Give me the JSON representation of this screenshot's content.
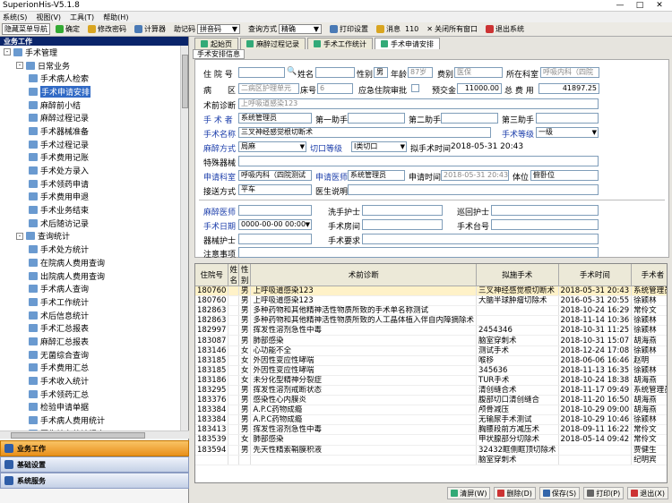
{
  "window": {
    "title": "SuperionHis-V5.1.8",
    "min": "—",
    "max": "□",
    "close": "✕"
  },
  "menu": [
    "系统(S)",
    "视图(V)",
    "工具(T)",
    "帮助(H)"
  ],
  "toolbar": {
    "hide_nav": "隐藏菜单导航",
    "confirm": "确定",
    "change_pwd": "修改密码",
    "calculator": "计算器",
    "mnemonic_label": "助记码",
    "mnemonic_value": "拼音码",
    "query_mode_label": "查询方式",
    "query_mode_value": "精确",
    "print_setup": "打印设置",
    "message_label": "消息",
    "message_count": "110",
    "close_all": "关闭所有窗口",
    "exit": "退出系统"
  },
  "sidebar": {
    "header": "业务工作",
    "tree": [
      {
        "label": "手术管理",
        "level": 0,
        "exp": "-"
      },
      {
        "label": "日常业务",
        "level": 1,
        "exp": "-"
      },
      {
        "label": "手术病人检索",
        "level": 2
      },
      {
        "label": "手术申请安排",
        "level": 2,
        "selected": true
      },
      {
        "label": "麻醉前小结",
        "level": 2
      },
      {
        "label": "麻醉过程记录",
        "level": 2
      },
      {
        "label": "手术器械准备",
        "level": 2
      },
      {
        "label": "手术过程记录",
        "level": 2
      },
      {
        "label": "手术费用记账",
        "level": 2
      },
      {
        "label": "手术处方录入",
        "level": 2
      },
      {
        "label": "手术领药申请",
        "level": 2
      },
      {
        "label": "手术费用申退",
        "level": 2
      },
      {
        "label": "手术业务结束",
        "level": 2
      },
      {
        "label": "术后随访记录",
        "level": 2
      },
      {
        "label": "查询统计",
        "level": 1,
        "exp": "-"
      },
      {
        "label": "手术处方统计",
        "level": 2
      },
      {
        "label": "在院病人费用查询",
        "level": 2
      },
      {
        "label": "出院病人费用查询",
        "level": 2
      },
      {
        "label": "手术病人查询",
        "level": 2
      },
      {
        "label": "手术工作统计",
        "level": 2
      },
      {
        "label": "术后信息统计",
        "level": 2
      },
      {
        "label": "手术汇总报表",
        "level": 2
      },
      {
        "label": "麻醉汇总报表",
        "level": 2
      },
      {
        "label": "无菌综合查询",
        "level": 2
      },
      {
        "label": "手术费用汇总",
        "level": 2
      },
      {
        "label": "手术收入统计",
        "level": 2
      },
      {
        "label": "手术领药汇总",
        "level": 2
      },
      {
        "label": "检验申请单据",
        "level": 2
      },
      {
        "label": "手术病人费用统计",
        "level": 2
      },
      {
        "label": "医生站台统计报表",
        "level": 2
      },
      {
        "label": "系统维护",
        "level": 1,
        "exp": "+"
      }
    ],
    "panels": [
      "业务工作",
      "基础设置",
      "系统服务"
    ]
  },
  "tabs": [
    "起始页",
    "麻醉过程记录",
    "手术工作统计",
    "手术申请安排"
  ],
  "subtab": "手术安排信息",
  "form": {
    "hosp_no_label": "住 院 号",
    "hosp_no": "",
    "name_label": "姓名",
    "name": "",
    "sex_label": "性别",
    "sex": "男",
    "age_label": "年龄",
    "age": "87岁",
    "fee_type_label": "费别",
    "fee_type": "医保",
    "dept_label": "所在科室",
    "dept": "呼吸内科（四院",
    "ward_label": "病　　区",
    "ward": "二病区护理单元",
    "bed_label": "床号",
    "bed": "6",
    "emergency_label": "应急住院审批",
    "prepay_label": "预交金",
    "prepay": "11000.00",
    "total_label": "总 费 用",
    "total": "41897.25",
    "pre_diag_label": "术前诊断",
    "pre_diag": "上呼吸道感染123",
    "surgeon_label": "手 术 者",
    "surgeon": "系统管理员",
    "asst1_label": "第一助手",
    "asst2_label": "第二助手",
    "asst3_label": "第三助手",
    "op_name_label": "手术名称",
    "op_name": "三叉神经感觉根切断术",
    "op_level_label": "手术等级",
    "op_level": "一级",
    "anes_label": "麻醉方式",
    "anes": "局麻",
    "incision_label": "切口等级",
    "incision": "I类切口",
    "plan_time_label": "拟手术时间",
    "plan_time": "2018-05-31 20:43",
    "special_label": "特殊器械",
    "req_dept_label": "申请科室",
    "req_dept": "呼吸内科（四院测试",
    "req_doc_label": "申请医师",
    "req_doc": "系统管理员",
    "req_time_label": "申请时间",
    "req_time": "2018-05-31 20:43:44",
    "position_label": "体位",
    "position": "俯卧位",
    "transport_label": "接送方式",
    "transport": "平车",
    "doc_note_label": "医生说明",
    "anes_doc_label": "麻醉医师",
    "scrub_label": "洗手护士",
    "circ_label": "巡回护士",
    "op_date_label": "手术日期",
    "op_date": "0000-00-00 00:00",
    "room_label": "手术房间",
    "table_label": "手术台号",
    "equip_label": "器械护士",
    "req_label": "手术要求",
    "notes_label": "注意事项"
  },
  "grid": {
    "columns": [
      "住院号",
      "姓名",
      "性别",
      "术前诊断",
      "拟施手术",
      "手术时间",
      "手术者",
      "申"
    ],
    "rows": [
      [
        "180760",
        "",
        "男",
        "上呼吸道感染123",
        "三叉神经感觉根切断术",
        "2018-05-31 20:43",
        "系统管理员",
        "系"
      ],
      [
        "180760",
        "",
        "男",
        "上呼吸道感染123",
        "大脑半球肿瘤切除术",
        "2016-05-31 20:55",
        "徐颖林",
        "系"
      ],
      [
        "182863",
        "",
        "男",
        "多种药物和其他精神活性物质所致的手术单名称测试",
        "",
        "2018-10-24 16:29",
        "常伶文",
        "系"
      ],
      [
        "182863",
        "",
        "男",
        "多种药物和其他精神活性物质所致的人工晶体植入伴自内障摘除术",
        "",
        "2018-11-14 10:36",
        "徐颖林",
        "系"
      ],
      [
        "182997",
        "",
        "男",
        "挥发性溶剂急性中毒",
        "2454346",
        "2018-10-31 11:25",
        "徐颖林",
        "系"
      ],
      [
        "183087",
        "",
        "男",
        "肺部感染",
        "脑室穿刺术",
        "2018-10-31 15:07",
        "胡海燕",
        "系"
      ],
      [
        "183146",
        "",
        "女",
        "心功能不全",
        "测试手术",
        "2018-12-24 17:08",
        "徐颖林",
        "系"
      ],
      [
        "183185",
        "",
        "女",
        "外因性变应性哮喘",
        "喉移",
        "2018-06-06 16:46",
        "赵明",
        "系"
      ],
      [
        "183185",
        "",
        "女",
        "外因性变应性哮喘",
        "345636",
        "2018-11-13 16:35",
        "徐颖林",
        "系"
      ],
      [
        "183186",
        "",
        "女",
        "未分化型精神分裂症",
        "TUR手术",
        "2018-10-24 18:38",
        "胡海燕",
        "系"
      ],
      [
        "183295",
        "",
        "男",
        "挥发性溶剂戒断状态",
        "清创缝合术",
        "2018-11-17 09:49",
        "系统管理员",
        "系"
      ],
      [
        "183376",
        "",
        "男",
        "感染性心内膜炎",
        "腹部切口清创缝合",
        "2018-11-20 16:50",
        "胡海燕",
        "系"
      ],
      [
        "183384",
        "",
        "男",
        "A.P.C药物成瘾",
        "颅骨减压",
        "2018-10-29 09:00",
        "胡海燕",
        "系"
      ],
      [
        "183384",
        "",
        "男",
        "A.P.C药物成瘾",
        "无输尿手术测试",
        "2018-10-29 10:46",
        "徐颖林",
        "系"
      ],
      [
        "183413",
        "",
        "男",
        "挥发性溶剂急性中毒",
        "胸腰段前方减压术",
        "2018-09-11 16:22",
        "常伶文",
        "系"
      ],
      [
        "183539",
        "",
        "女",
        "肺部感染",
        "甲状腺部分切除术",
        "2018-05-14 09:42",
        "常伶文",
        "系"
      ],
      [
        "183594",
        "",
        "男",
        "先天性精索鞘膜积液",
        "32432眶侧眶顶切除术",
        "",
        "贾健生",
        "系"
      ],
      [
        "",
        "",
        "",
        "",
        "脑室穿刺术",
        "",
        "纪明宾",
        "系"
      ]
    ]
  },
  "bottom": [
    "清屏(W)",
    "删除(D)",
    "保存(S)",
    "打印(P)",
    "退出(X)"
  ]
}
